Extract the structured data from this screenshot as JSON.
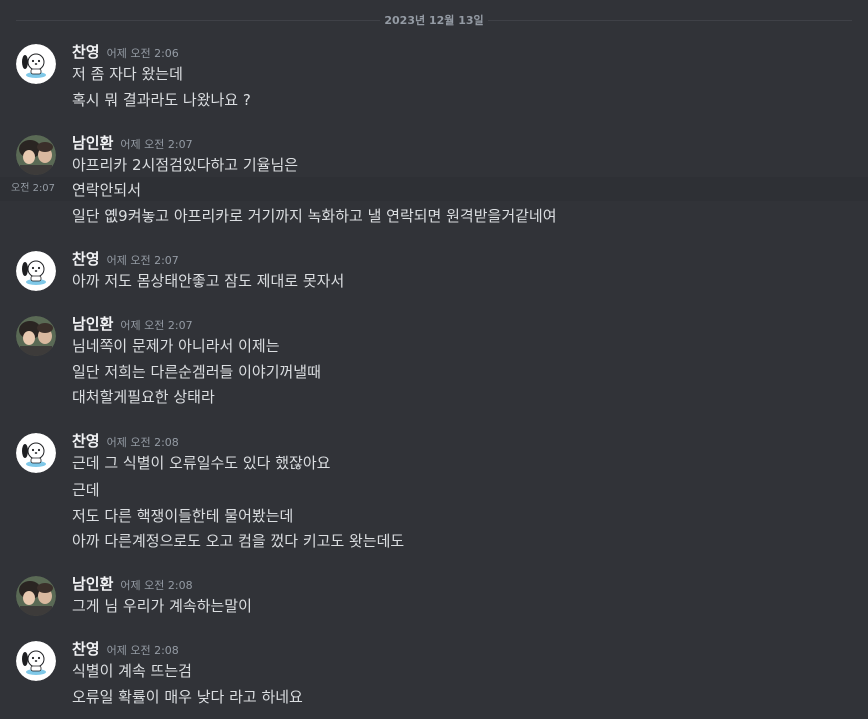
{
  "date_divider": "2023년 12월 13일",
  "groups": [
    {
      "author": "찬영",
      "avatar_icon": "pochacco-icon",
      "timestamp": "어제 오전 2:06",
      "lines": [
        "저 좀 자다 왔는데",
        "혹시 뭐 결과라도 나왔나요 ?"
      ]
    },
    {
      "author": "남인환",
      "avatar_icon": "photo-avatar-icon",
      "timestamp": "어제 오전 2:07",
      "lines": [
        "아프리카 2시점검있다하고 기율님은",
        "연락안되서",
        "일단 옚9켜놓고 아프리카로 거기까지 녹화하고 낼 연락되면 원격받을거같네여"
      ],
      "hover_time": "오전 2:07"
    },
    {
      "author": "찬영",
      "avatar_icon": "pochacco-icon",
      "timestamp": "어제 오전 2:07",
      "lines": [
        "아까 저도 몸상태안좋고 잠도 제대로 못자서"
      ]
    },
    {
      "author": "남인환",
      "avatar_icon": "photo-avatar-icon",
      "timestamp": "어제 오전 2:07",
      "lines": [
        "님네쪽이 문제가 아니라서 이제는",
        "일단 저희는 다른순겜러들 이야기꺼낼때",
        "대처할게필요한 상태라"
      ]
    },
    {
      "author": "찬영",
      "avatar_icon": "pochacco-icon",
      "timestamp": "어제 오전 2:08",
      "lines": [
        "근데 그 식별이 오류일수도 있다 했잖아요",
        "근데",
        "저도 다른 핵쟁이들한테 물어봤는데",
        "아까 다른계정으로도 오고 컴을 껐다 키고도 왓는데도"
      ]
    },
    {
      "author": "남인환",
      "avatar_icon": "photo-avatar-icon",
      "timestamp": "어제 오전 2:08",
      "lines": [
        "그게 님 우리가 계속하는말이"
      ]
    },
    {
      "author": "찬영",
      "avatar_icon": "pochacco-icon",
      "timestamp": "어제 오전 2:08",
      "lines": [
        "식별이 계속 뜨는검",
        "오류일 확률이 매우 낮다 라고 하네요"
      ]
    }
  ],
  "colors": {
    "background": "#313338",
    "author": "#f2f3f5",
    "message": "#dbdee1",
    "muted": "#949ba4",
    "hover": "#2e3035"
  }
}
